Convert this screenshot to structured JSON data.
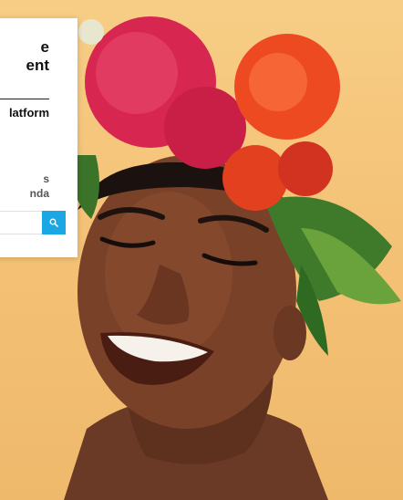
{
  "card": {
    "title": "e\nent",
    "subtitle": "latform",
    "description": "s\nnda",
    "search": {
      "placeholder": ""
    },
    "search_button_icon": "search-icon"
  },
  "colors": {
    "background": "#f5c77e",
    "card": "#ffffff",
    "accent": "#1aa7e4",
    "title_text": "#111111",
    "description_text": "#555555"
  }
}
